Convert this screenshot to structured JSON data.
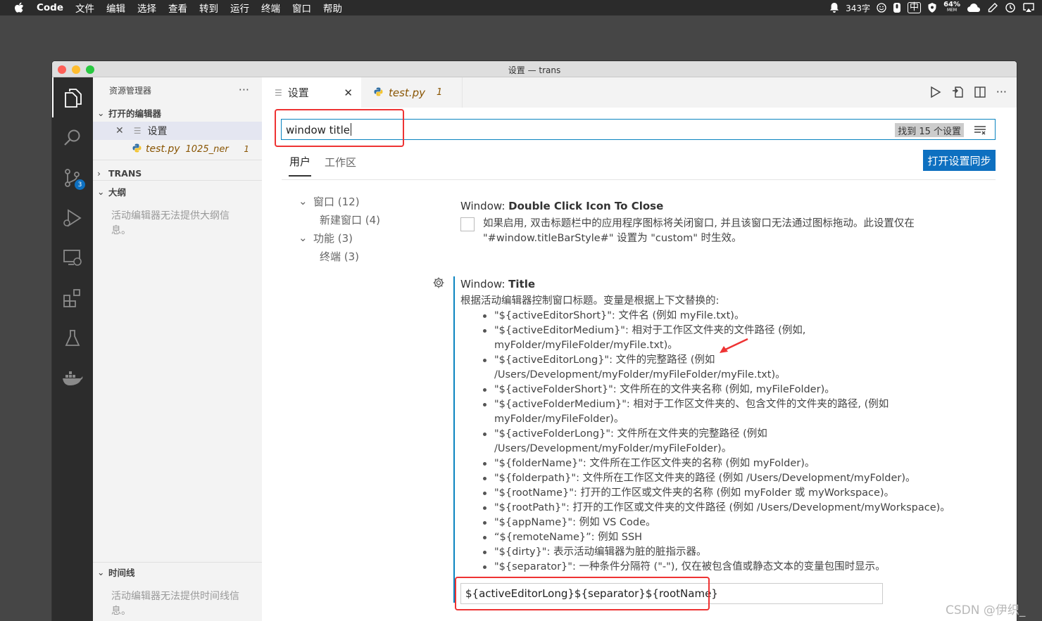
{
  "menubar": {
    "app": "Code",
    "items": [
      "文件",
      "编辑",
      "选择",
      "查看",
      "转到",
      "运行",
      "终端",
      "窗口",
      "帮助"
    ],
    "char_count": "343字",
    "input_method": "中",
    "battery": "64%",
    "mem": "MEM"
  },
  "window": {
    "title": "设置 — trans"
  },
  "activity_bar": {
    "icons": [
      "explorer-icon",
      "search-icon",
      "source-control-icon",
      "run-debug-icon",
      "remote-explorer-icon",
      "extensions-icon",
      "testing-icon",
      "docker-icon"
    ],
    "scm_badge": "3"
  },
  "sidebar": {
    "header": "资源管理器",
    "more": "···",
    "open_editors": {
      "label": "打开的编辑器",
      "items": [
        {
          "name": "设置",
          "selected": true
        },
        {
          "name": "test.py",
          "detail": "1025_ner",
          "problems": "1"
        }
      ]
    },
    "workspace_label": "TRANS",
    "outline": {
      "label": "大纲",
      "empty": "活动编辑器无法提供大纲信息。"
    },
    "timeline": {
      "label": "时间线",
      "empty": "活动编辑器无法提供时间线信息。"
    }
  },
  "tabs": [
    {
      "label": "设置",
      "active": true
    },
    {
      "label": "test.py",
      "problems": "1",
      "active": false
    }
  ],
  "settings": {
    "search_value": "window title",
    "found_text": "找到 15 个设置",
    "scopes": [
      "用户",
      "工作区"
    ],
    "active_scope": "用户",
    "sync_button": "打开设置同步",
    "toc": [
      {
        "label": "窗口 (12)",
        "level": 1,
        "expanded": true
      },
      {
        "label": "新建窗口 (4)",
        "level": 2
      },
      {
        "label": "功能 (3)",
        "level": 1,
        "expanded": true
      },
      {
        "label": "终端 (3)",
        "level": 2
      }
    ],
    "double_click": {
      "prefix": "Window: ",
      "name": "Double Click Icon To Close",
      "desc1": "如果启用, 双击标题栏中的应用程序图标将关闭窗口, 并且该窗口无法通过图标拖动。此设置仅在",
      "desc2": "\"#window.titleBarStyle#\" 设置为 \"custom\" 时生效。",
      "checked": false
    },
    "title_setting": {
      "prefix": "Window: ",
      "name": "Title",
      "desc": "根据活动编辑器控制窗口标题。变量是根据上下文替换的:",
      "bullets": [
        [
          "\"${activeEditorShort}\": 文件名 (例如 myFile.txt)。"
        ],
        [
          "\"${activeEditorMedium}\": 相对于工作区文件夹的文件路径 (例如,",
          "myFolder/myFileFolder/myFile.txt)。"
        ],
        [
          "\"${activeEditorLong}\": 文件的完整路径 (例如",
          "/Users/Development/myFolder/myFileFolder/myFile.txt)。"
        ],
        [
          "\"${activeFolderShort}\": 文件所在的文件夹名称 (例如, myFileFolder)。"
        ],
        [
          "\"${activeFolderMedium}\": 相对于工作区文件夹的、包含文件的文件夹的路径, (例如",
          "myFolder/myFileFolder)。"
        ],
        [
          "\"${activeFolderLong}\": 文件所在文件夹的完整路径 (例如",
          "/Users/Development/myFolder/myFileFolder)。"
        ],
        [
          "\"${folderName}\": 文件所在工作区文件夹的名称 (例如 myFolder)。"
        ],
        [
          "\"${folderpath}\": 文件所在工作区文件夹的路径 (例如 /Users/Development/myFolder)。"
        ],
        [
          "\"${rootName}\": 打开的工作区或文件夹的名称 (例如 myFolder 或 myWorkspace)。"
        ],
        [
          "\"${rootPath}\": 打开的工作区或文件夹的文件路径 (例如 /Users/Development/myWorkspace)。"
        ],
        [
          "\"${appName}\": 例如 VS Code。"
        ],
        [
          "“${remoteName}”: 例如 SSH"
        ],
        [
          "\"${dirty}\": 表示活动编辑器为脏的脏指示器。"
        ],
        [
          "\"${separator}\": 一种条件分隔符 (\"-\"), 仅在被包含值或静态文本的变量包围时显示。"
        ]
      ],
      "value": "${activeEditorLong}${separator}${rootName}"
    }
  },
  "watermark": "CSDN @伊织_",
  "colors": {
    "accent": "#0e70c0",
    "annotation": "#e33333",
    "python": "#3572A5",
    "warning": "#895503"
  }
}
